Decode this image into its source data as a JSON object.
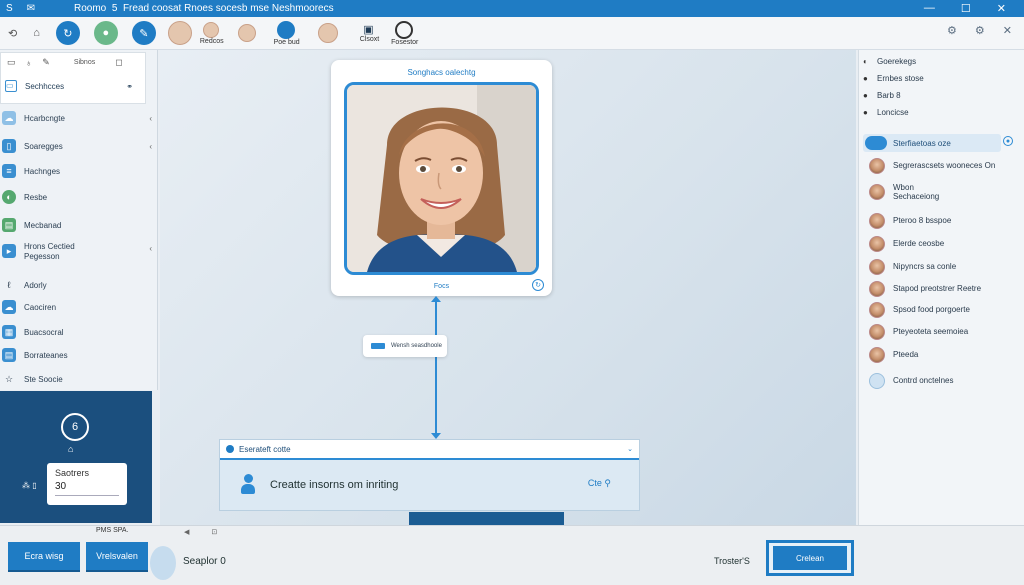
{
  "titlebar": {
    "left_icons": [
      "S",
      "✉"
    ],
    "app_name": "Roomo",
    "number": "5",
    "title": "Fread coosat Rnoes socesb mse Neshmoorecs",
    "controls": [
      "—",
      "☐",
      "✕"
    ]
  },
  "toolbar": {
    "labels": [
      "Redcos",
      "Poe bud",
      "Clsoxt",
      "Fosestor"
    ],
    "right_icons": [
      "⚙",
      "⚙",
      "✕"
    ]
  },
  "sidebar": {
    "card_icons": [
      "▭",
      "✎",
      "◻"
    ],
    "card_label": "Sibnos",
    "card_sub": "Sechhcces",
    "items": [
      {
        "label": "Hcarbcngte",
        "chev": "‹"
      },
      {
        "label": "Soaregges",
        "chev": "‹"
      },
      {
        "label": "Hachnges",
        "chev": ""
      },
      {
        "label": "Resbe",
        "chev": ""
      },
      {
        "label": "Mecbanad",
        "chev": ""
      },
      {
        "label": "Hrons Cectied",
        "sub": "Pegesson",
        "chev": "‹"
      },
      {
        "label": "Adorly",
        "chev": ""
      },
      {
        "label": "Caociren",
        "chev": ""
      },
      {
        "label": "Buacsocral",
        "chev": ""
      },
      {
        "label": "Borrateanes",
        "chev": ""
      },
      {
        "label": "Ste Soocie",
        "chev": ""
      }
    ]
  },
  "darkpanel": {
    "circle": "6",
    "card_label": "Saotrers",
    "card_value": "30"
  },
  "photo_card": {
    "title": "Songhacs oalechtg",
    "footer": "Focs",
    "button": "↻"
  },
  "mid_pill": {
    "label": "Wensh seasdhoole"
  },
  "bottom_card": {
    "header": "Eserateft cotte",
    "body": "Creatte insorns om inriting",
    "tail": "Cte ⚲"
  },
  "right_panel": {
    "top_items": [
      {
        "icon": "◐",
        "label": "Goerekegs"
      },
      {
        "icon": "●",
        "label": "Ernbes stose"
      },
      {
        "icon": "●",
        "label": "Barb 8"
      },
      {
        "icon": "●",
        "label": "Loncicse"
      }
    ],
    "search": "Sterfiaetoas oze",
    "contacts": [
      {
        "name": "Segrerascsets wooneces On"
      },
      {
        "name": "Wbon Sechaceiong"
      },
      {
        "name": "Pteroo 8 bsspoe"
      },
      {
        "name": "Elerde ceosbe"
      },
      {
        "name": "Nipyncrs sa conle"
      },
      {
        "name": "Stapod preotstrer Reetre"
      },
      {
        "name": "Spsod food porgoerte"
      },
      {
        "name": "Pteyeoteta seemoiea"
      },
      {
        "name": "Pteeda"
      },
      {
        "name": "Contrd onctelnes"
      }
    ]
  },
  "statusbar": {
    "small": "PMS SPA.",
    "tiny": [
      "◀",
      "⊡"
    ],
    "btn1": "Ecra wisg",
    "btn2": "Vrelsvalen",
    "text": "Seaplor 0",
    "right_text": "Troster'S",
    "right_btn": "Crelean"
  },
  "colors": {
    "accent": "#1f7cc4",
    "dark_panel": "#1b4f7e"
  }
}
